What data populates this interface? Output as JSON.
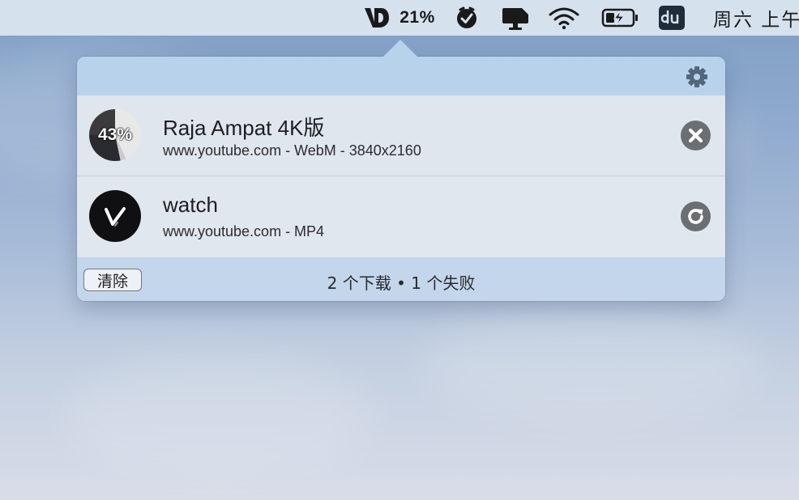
{
  "menubar": {
    "downloader_percent": "21%",
    "clock": "周六 上午"
  },
  "downloads": [
    {
      "title": "Raja Ampat 4K版",
      "subtitle": "www.youtube.com - WebM - 3840x2160",
      "progress_label": "43%",
      "progress": 0.43,
      "action": "cancel"
    },
    {
      "title": "watch",
      "subtitle": "www.youtube.com - MP4",
      "action": "retry"
    }
  ],
  "footer": {
    "clear_label": "清除",
    "status": "2 个下载 • 1 个失败"
  },
  "colors": {
    "header": "#b9d2ec",
    "footer": "#c3d6eb",
    "action_button": "#6b6e72"
  }
}
